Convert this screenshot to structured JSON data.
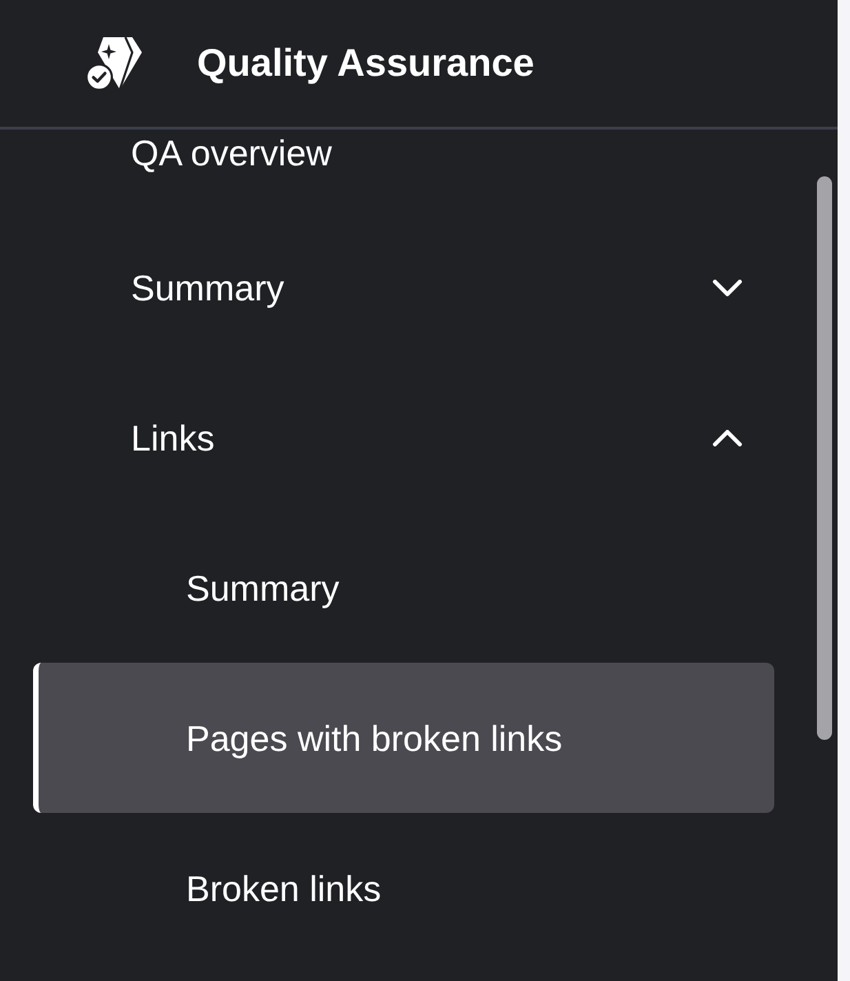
{
  "header": {
    "title": "Quality Assurance"
  },
  "nav": [
    {
      "kind": "link",
      "label": "QA overview",
      "selected": false
    },
    {
      "kind": "group",
      "label": "Summary",
      "expanded": false,
      "selected": false
    },
    {
      "kind": "group",
      "label": "Links",
      "expanded": true,
      "selected": false,
      "children": [
        {
          "label": "Summary",
          "selected": false
        },
        {
          "label": "Pages with broken links",
          "selected": true
        },
        {
          "label": "Broken links",
          "selected": false
        }
      ]
    }
  ]
}
